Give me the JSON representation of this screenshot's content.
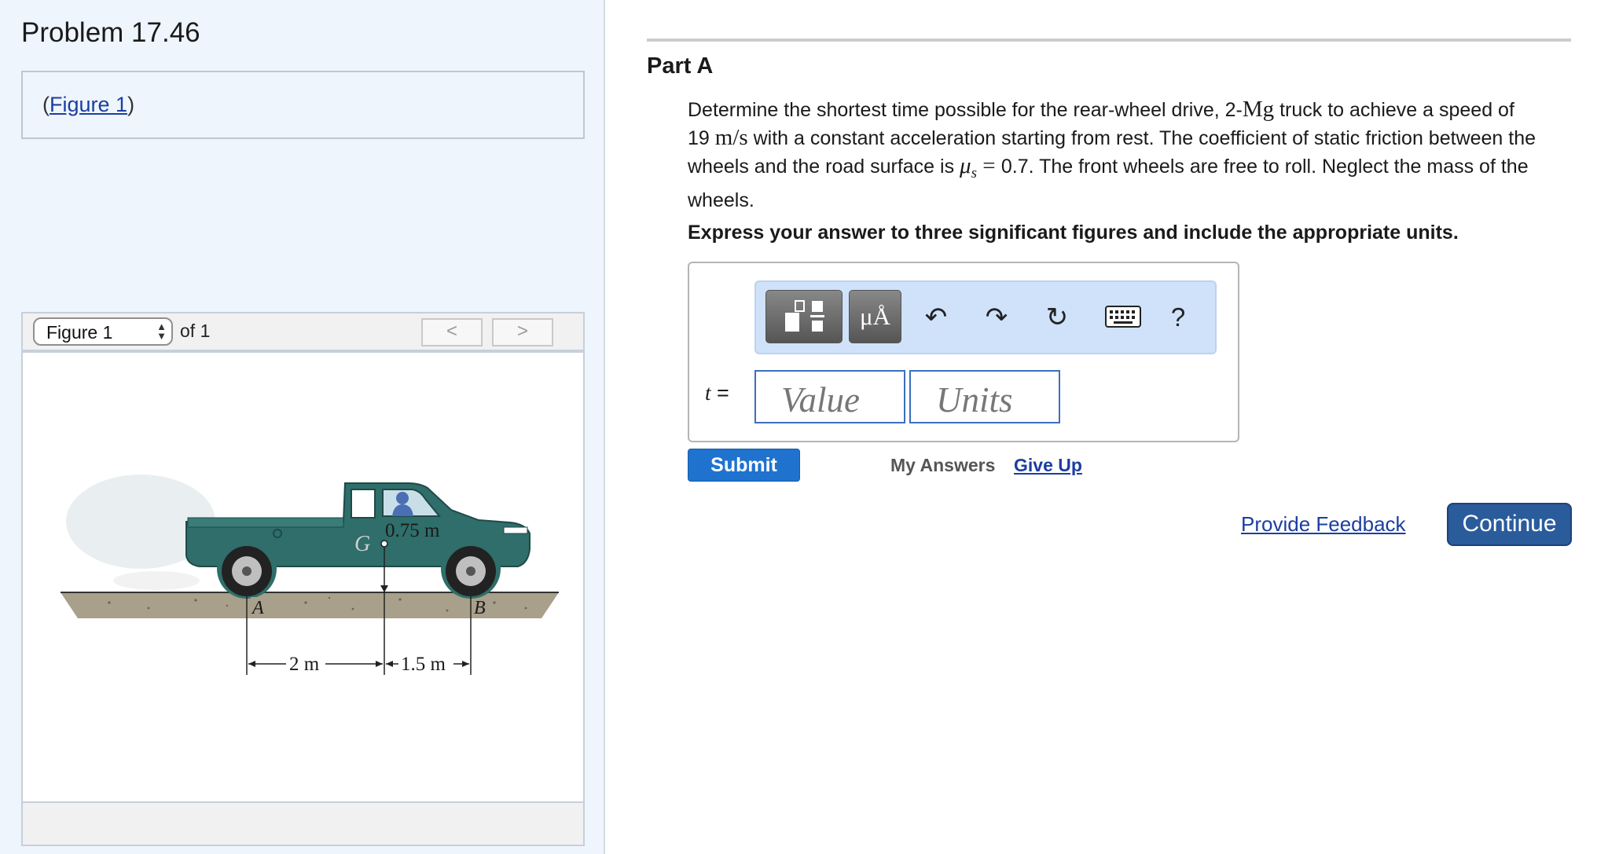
{
  "problem": {
    "title": "Problem 17.46",
    "figure_link_prefix": "(",
    "figure_link_label": "Figure 1",
    "figure_link_suffix": ")"
  },
  "figure_viewer": {
    "selected_figure": "Figure 1",
    "of_label": "of 1",
    "prev_icon": "chevron-left-icon",
    "next_icon": "chevron-right-icon",
    "figure": {
      "label_G": "G",
      "label_A": "A",
      "label_B": "B",
      "height_label": "0.75 m",
      "dim_left": "2 m",
      "dim_right": "1.5 m",
      "truck_color": "#2f6e6a"
    }
  },
  "part": {
    "title": "Part A",
    "text_1": "Determine the shortest time possible for the rear-wheel drive, 2-",
    "mass_unit": "Mg",
    "text_2": " truck to achieve a speed of",
    "speed_value": "19 ",
    "speed_unit": "m/s",
    "text_3": " with a constant acceleration starting from rest. The coefficient of static friction between the wheels and the road surface is ",
    "mu_symbol": "μ",
    "mu_sub": "s",
    "equals": " = ",
    "mu_value": "0.7",
    "text_4": ". The front wheels are free to roll. Neglect the mass of the wheels.",
    "instruction": "Express your answer to three significant figures and include the appropriate units."
  },
  "answer": {
    "variable": "t",
    "equals": " =",
    "value_placeholder": "Value",
    "units_placeholder": "Units",
    "toolbar": {
      "templates_icon": "templates-icon",
      "symbols_label": "μÅ",
      "undo_icon": "undo-icon",
      "redo_icon": "redo-icon",
      "reset_icon": "reset-icon",
      "keyboard_icon": "keyboard-icon",
      "help_label": "?"
    }
  },
  "actions": {
    "submit_label": "Submit",
    "my_answers_label": "My Answers",
    "give_up_label": "Give Up",
    "provide_feedback_label": "Provide Feedback",
    "continue_label": "Continue"
  },
  "colors": {
    "left_panel_bg": "#eef5fc",
    "link": "#1c3ea0",
    "submit": "#1f73cf",
    "continue": "#2a5c9c",
    "toolbar_bg": "#cfe2fa"
  }
}
